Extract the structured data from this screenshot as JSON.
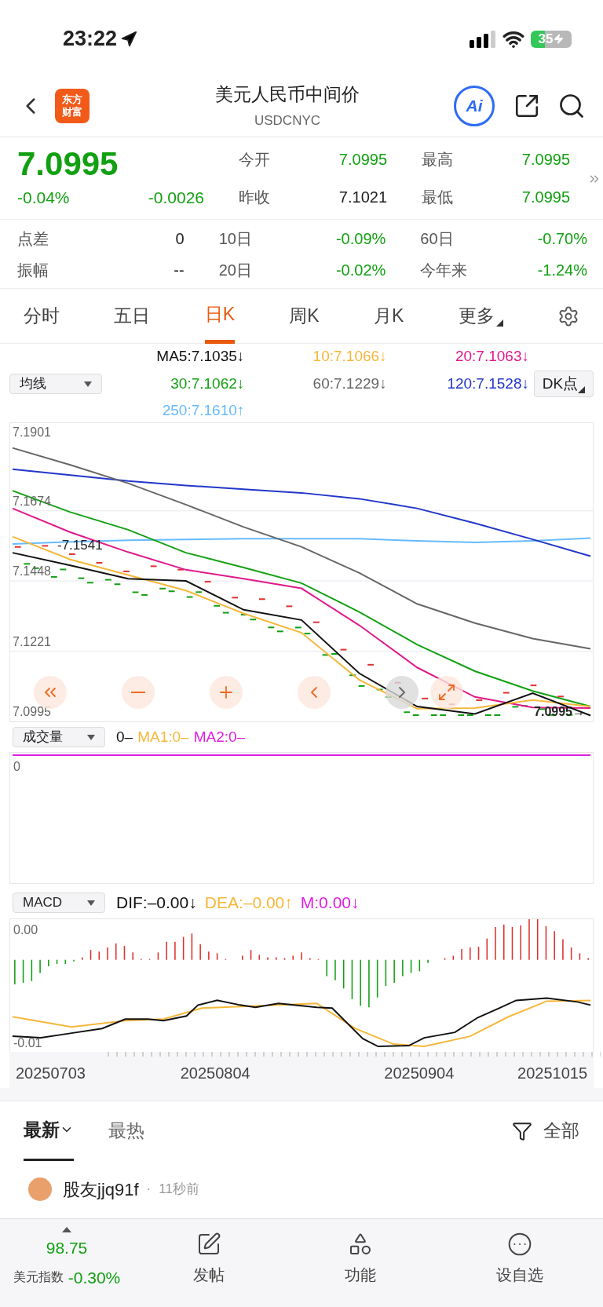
{
  "status_bar": {
    "time": "23:22",
    "battery": "35"
  },
  "header": {
    "logo": [
      "东方",
      "财富"
    ],
    "title": "美元人民币中间价",
    "subtitle": "USDCNYC",
    "ai_label": "Ai"
  },
  "quote": {
    "price": "7.0995",
    "change_pct": "-0.04%",
    "change": "-0.0026",
    "down": true,
    "fields": [
      {
        "label": "今开",
        "value": "7.0995",
        "down": true
      },
      {
        "label": "最高",
        "value": "7.0995",
        "down": true
      },
      {
        "label": "昨收",
        "value": "7.1021",
        "down": false
      },
      {
        "label": "最低",
        "value": "7.0995",
        "down": true
      }
    ]
  },
  "stats": [
    {
      "label": "点差",
      "value": "0",
      "down": false
    },
    {
      "label": "10日",
      "value": "-0.09%",
      "down": true
    },
    {
      "label": "60日",
      "value": "-0.70%",
      "down": true
    },
    {
      "label": "振幅",
      "value": "--",
      "down": false
    },
    {
      "label": "20日",
      "value": "-0.02%",
      "down": true
    },
    {
      "label": "今年来",
      "value": "-1.24%",
      "down": true
    }
  ],
  "period_tabs": [
    {
      "label": "分时",
      "selected": false,
      "kind": "tab"
    },
    {
      "label": "五日",
      "selected": false,
      "kind": "tab"
    },
    {
      "label": "日K",
      "selected": true,
      "kind": "tab"
    },
    {
      "label": "周K",
      "selected": false,
      "kind": "tab"
    },
    {
      "label": "月K",
      "selected": false,
      "kind": "tab"
    },
    {
      "label": "更多",
      "selected": false,
      "kind": "menu"
    }
  ],
  "ma_selector": "均线",
  "dk_button": "DK点",
  "ma_legend": [
    {
      "value": ":7.1035↓"
    },
    {
      "value": ":7.1066↓"
    },
    {
      "value": ":7.1063↓"
    },
    {
      "value": ":7.1062↓"
    },
    {
      "value": ":7.1229↓"
    },
    {
      "value": ":7.1528↓"
    },
    {
      "value": ":7.1610↑"
    }
  ],
  "main_chart": {
    "high_marker": "-7.1541",
    "last_marker": "7.0995→",
    "chart_data": {
      "type": "line",
      "grid": true,
      "ylim": [
        7.0995,
        7.1957
      ],
      "yticks": [
        7.1901,
        7.1674,
        7.1448,
        7.1221,
        7.0995
      ],
      "series": [
        {
          "name": "MA5",
          "color": "#111111",
          "values": [
            7.1539,
            7.1498,
            7.1455,
            7.1448,
            7.1355,
            7.1322,
            7.115,
            7.1043,
            7.1019,
            7.1086,
            7.1014
          ]
        },
        {
          "name": "10",
          "color": "#f5b73b",
          "values": [
            7.1591,
            7.1517,
            7.1467,
            7.1417,
            7.1343,
            7.1281,
            7.1129,
            7.1036,
            7.1038,
            7.1064,
            7.1043
          ]
        },
        {
          "name": "20",
          "color": "#e0198a",
          "values": [
            7.1682,
            7.1605,
            7.1541,
            7.1484,
            7.1455,
            7.1424,
            7.1305,
            7.1169,
            7.1074,
            7.104,
            7.1038
          ]
        },
        {
          "name": "30",
          "color": "#12a012",
          "values": [
            7.1739,
            7.167,
            7.1613,
            7.1539,
            7.1491,
            7.1441,
            7.1348,
            7.1243,
            7.1157,
            7.1093,
            7.1043
          ]
        },
        {
          "name": "60",
          "color": "#666666",
          "values": [
            7.1877,
            7.1822,
            7.1763,
            7.1694,
            7.1622,
            7.1558,
            7.1474,
            7.1374,
            7.1312,
            7.1262,
            7.1229
          ]
        },
        {
          "name": "120",
          "color": "#2236c9",
          "values": [
            7.1808,
            7.1789,
            7.177,
            7.1756,
            7.1744,
            7.1732,
            7.1713,
            7.1682,
            7.1634,
            7.1582,
            7.1528
          ]
        },
        {
          "name": "250",
          "color": "#66bbff",
          "values": [
            7.1567,
            7.1574,
            7.1579,
            7.1582,
            7.1584,
            7.1584,
            7.1584,
            7.1577,
            7.1572,
            7.1577,
            7.1586
          ]
        }
      ]
    }
  },
  "volume": {
    "selector": "成交量",
    "legend": [
      {
        "text": "0–",
        "color": "#111111"
      },
      {
        "text": "MA1:0–",
        "color": "#f5b73b"
      },
      {
        "text": "MA2:0–",
        "color": "#e020e0"
      }
    ],
    "y_label": "0"
  },
  "macd": {
    "selector": "MACD",
    "legend": [
      {
        "text": "DIF:–0.00↓",
        "color": "#111111"
      },
      {
        "text": "DEA:–0.00↑",
        "color": "#f5b73b"
      },
      {
        "text": "M:0.00↓",
        "color": "#e020e0"
      }
    ],
    "y_labels": [
      "0.00",
      "-0.01"
    ],
    "dates": [
      "20250703",
      "20250804",
      "20250904",
      "20251015"
    ]
  },
  "comments": {
    "tabs": [
      {
        "label": "最新",
        "selected": true
      },
      {
        "label": "最热",
        "selected": false
      }
    ],
    "filter": "全部",
    "post": {
      "user": "股友jjq91f",
      "separator": "·",
      "time": "11秒前"
    }
  },
  "bottom_bar": {
    "index_value": "98.75",
    "index_name": "美元指数",
    "index_change": "-0.30%",
    "actions": [
      {
        "label": "发帖",
        "kind": "post"
      },
      {
        "label": "功能",
        "kind": "apps"
      },
      {
        "label": "设自选",
        "kind": "more"
      }
    ]
  }
}
